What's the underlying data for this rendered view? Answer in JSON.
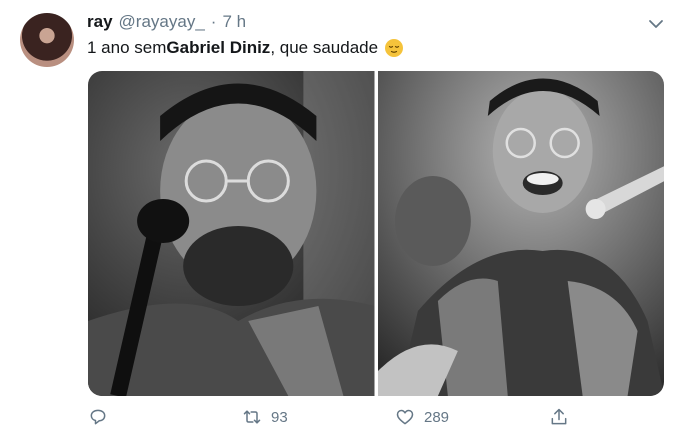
{
  "tweet": {
    "author": {
      "name": "ray",
      "handle": "@rayayay_",
      "separator": "·",
      "time": "7 h"
    },
    "text": {
      "before": "1 ano sem ",
      "bold": "Gabriel Diniz",
      "after": ", que saudade"
    },
    "emoji": "relieved-face-emoji",
    "media": {
      "count": 2,
      "style": "black-and-white photos"
    },
    "actions": {
      "reply_count": "",
      "retweet_count": "93",
      "like_count": "289",
      "share_count": ""
    },
    "colors": {
      "text": "#14171a",
      "muted": "#657786",
      "emoji": "#f5c33b"
    }
  }
}
